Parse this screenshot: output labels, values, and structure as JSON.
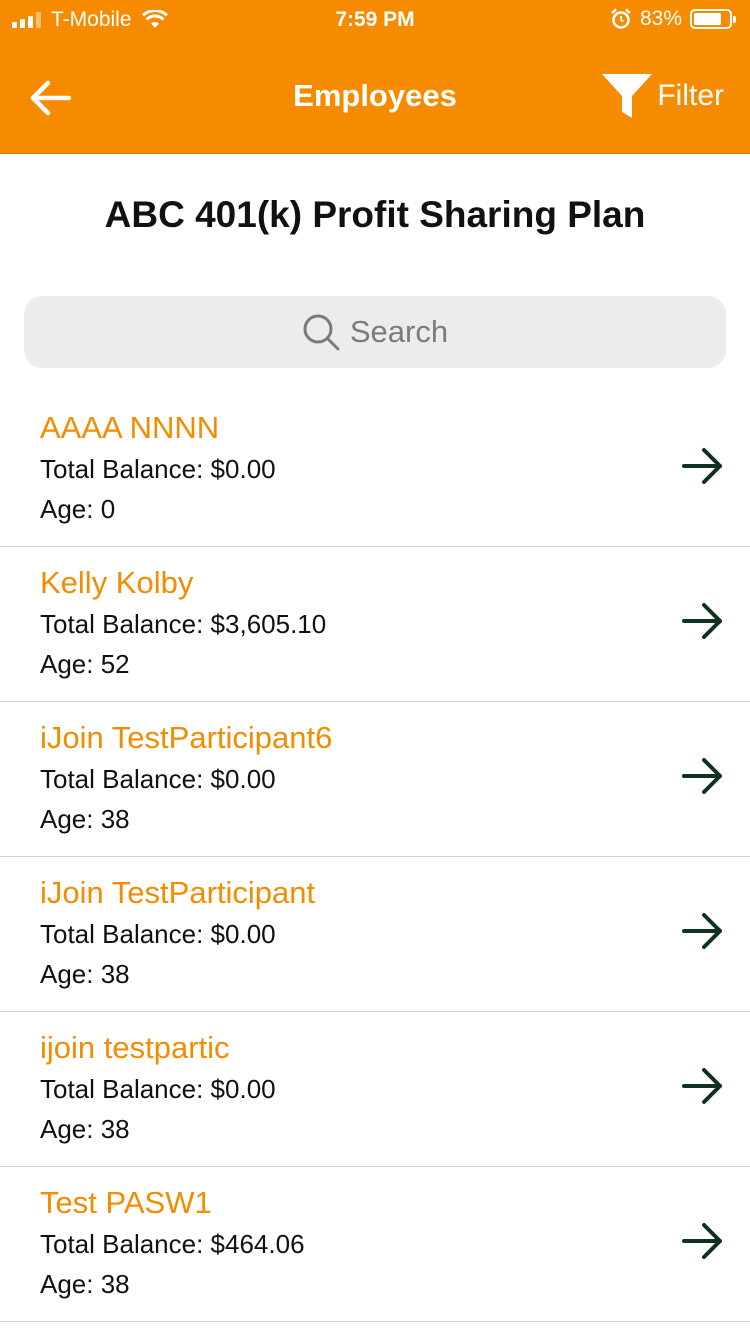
{
  "status": {
    "carrier": "T-Mobile",
    "time": "7:59 PM",
    "battery": "83%"
  },
  "nav": {
    "title": "Employees",
    "filter_label": "Filter"
  },
  "plan_title": "ABC 401(k) Profit Sharing Plan",
  "search": {
    "placeholder": "Search"
  },
  "employees": [
    {
      "name": "AAAA NNNN",
      "balance": "Total Balance: $0.00",
      "age": "Age: 0"
    },
    {
      "name": "Kelly Kolby",
      "balance": "Total Balance: $3,605.10",
      "age": "Age: 52"
    },
    {
      "name": "iJoin TestParticipant6",
      "balance": "Total Balance: $0.00",
      "age": "Age: 38"
    },
    {
      "name": "iJoin TestParticipant",
      "balance": "Total Balance: $0.00",
      "age": "Age: 38"
    },
    {
      "name": "ijoin testpartic",
      "balance": "Total Balance: $0.00",
      "age": "Age: 38"
    },
    {
      "name": "Test PASW1",
      "balance": "Total Balance: $464.06",
      "age": "Age: 38"
    }
  ],
  "colors": {
    "accent": "#F68B00",
    "name_text": "#F28C00",
    "arrow": "#0f3320"
  }
}
